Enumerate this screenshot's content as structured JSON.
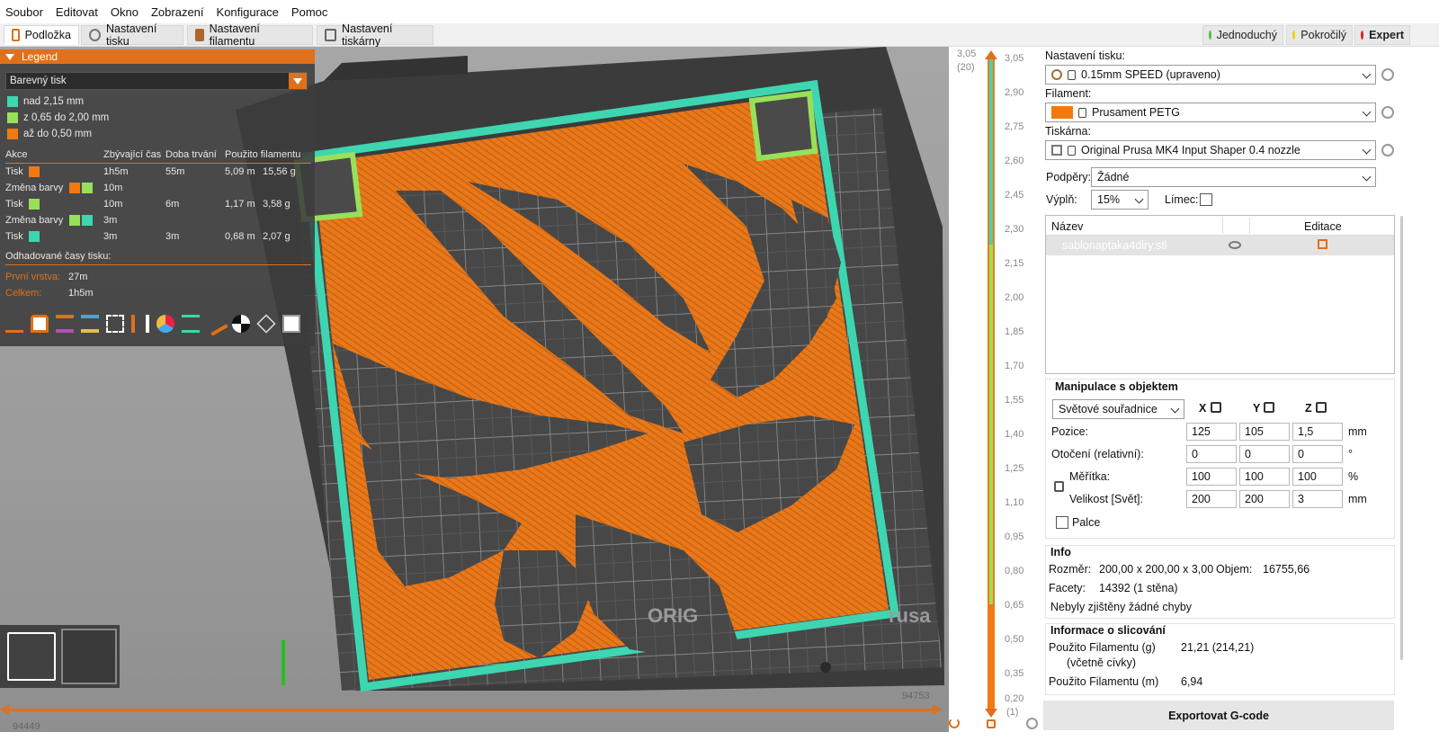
{
  "menu": [
    "Soubor",
    "Editovat",
    "Okno",
    "Zobrazení",
    "Konfigurace",
    "Pomoc"
  ],
  "tabs": [
    "Podložka",
    "Nastavení tisku",
    "Nastavení filamentu",
    "Nastavení tiskárny"
  ],
  "modes": [
    {
      "label": "Jednoduchý",
      "color": "#4cc43a"
    },
    {
      "label": "Pokročilý",
      "color": "#f3d100"
    },
    {
      "label": "Expert",
      "color": "#e21c1c"
    }
  ],
  "legend": {
    "title": "Legend",
    "view_type": "Barevný tisk",
    "color_ranges": [
      {
        "label": "nad 2,15 mm",
        "color": "#3dd6b0"
      },
      {
        "label": "z 0,65 do 2,00 mm",
        "color": "#99e05a"
      },
      {
        "label": "až do 0,50 mm",
        "color": "#f07a12"
      }
    ],
    "headers": [
      "Akce",
      "Zbývající čas",
      "Doba trvání",
      "Použito filamentu"
    ],
    "rows": [
      {
        "action": "Tisk",
        "swatches": [
          "#f07a12"
        ],
        "remaining": "1h5m",
        "duration": "55m",
        "length": "5,09 m",
        "weight": "15,56 g"
      },
      {
        "action": "Změna barvy",
        "swatches": [
          "#f07a12",
          "#99e05a"
        ],
        "remaining": "10m",
        "duration": "",
        "length": "",
        "weight": ""
      },
      {
        "action": "Tisk",
        "swatches": [
          "#99e05a"
        ],
        "remaining": "10m",
        "duration": "6m",
        "length": "1,17 m",
        "weight": "3,58 g"
      },
      {
        "action": "Změna barvy",
        "swatches": [
          "#99e05a",
          "#3dd6b0"
        ],
        "remaining": "3m",
        "duration": "",
        "length": "",
        "weight": ""
      },
      {
        "action": "Tisk",
        "swatches": [
          "#3dd6b0"
        ],
        "remaining": "3m",
        "duration": "3m",
        "length": "0,68 m",
        "weight": "2,07 g"
      }
    ],
    "estimates_title": "Odhadované časy tisku:",
    "first_layer_label": "První vrstva:",
    "first_layer_value": "27m",
    "total_label": "Celkem:",
    "total_value": "1h5m"
  },
  "bed": {
    "brand_text_1": "ORIG",
    "brand_text_2": "rusa"
  },
  "hslider": {
    "right_value": "94753",
    "left_value": "94449"
  },
  "vslider": {
    "top_value": "3,05",
    "top_layer": "(20)",
    "bottom_value": "0,20",
    "bottom_layer": "(1)",
    "ticks": [
      "3,05",
      "2,90",
      "2,75",
      "2,60",
      "2,45",
      "2,30",
      "2,15",
      "2,00",
      "1,85",
      "1,70",
      "1,55",
      "1,40",
      "1,25",
      "1,10",
      "0,95",
      "0,80",
      "0,65",
      "0,50",
      "0,35",
      "0,20"
    ]
  },
  "sidebar": {
    "print_settings_label": "Nastavení tisku:",
    "print_settings_value": "0.15mm SPEED (upraveno)",
    "filament_label": "Filament:",
    "filament_value": "Prusament PETG",
    "filament_color": "#f07a12",
    "printer_label": "Tiskárna:",
    "printer_value": "Original Prusa MK4 Input Shaper 0.4 nozzle",
    "supports_label": "Podpěry:",
    "supports_value": "Žádné",
    "infill_label": "Výplň:",
    "infill_value": "15%",
    "brim_label": "Límec:",
    "list_header_name": "Název",
    "list_header_edit": "Editace",
    "object_name": "sablonaptaka4diry.stl"
  },
  "manipulation": {
    "title": "Manipulace s objektem",
    "coord_system": "Světové souřadnice",
    "axes": [
      "X",
      "Y",
      "Z"
    ],
    "rows": [
      {
        "label": "Pozice:",
        "values": [
          "125",
          "105",
          "1,5"
        ],
        "unit": "mm"
      },
      {
        "label": "Otočení (relativní):",
        "values": [
          "0",
          "0",
          "0"
        ],
        "unit": "°"
      },
      {
        "label": "Měřítka:",
        "values": [
          "100",
          "100",
          "100"
        ],
        "unit": "%"
      },
      {
        "label": "Velikost [Svět]:",
        "values": [
          "200",
          "200",
          "3"
        ],
        "unit": "mm"
      }
    ],
    "inches_label": "Palce"
  },
  "info": {
    "title": "Info",
    "size_label": "Rozměr:",
    "size_value": "200,00 x 200,00 x 3,00",
    "volume_label": "Objem:",
    "volume_value": "16755,66",
    "facets_label": "Facety:",
    "facets_value": "14392 (1 stěna)",
    "errors_text": "Nebyly zjištěny žádné chyby"
  },
  "slice_info": {
    "title": "Informace o slicování",
    "filament_g_label": "Použito Filamentu (g)",
    "filament_g_sub": "(včetně cívky)",
    "filament_g_value": "21,21 (214,21)",
    "filament_m_label": "Použito Filamentu (m)",
    "filament_m_value": "6,94"
  },
  "export_label": "Exportovat G-code"
}
